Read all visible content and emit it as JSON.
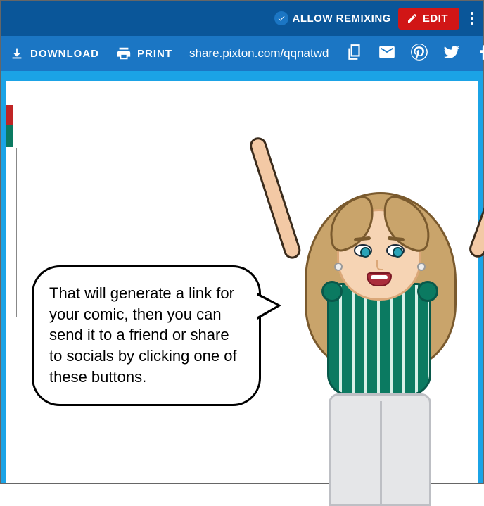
{
  "topbar": {
    "allow_remixing": "ALLOW REMIXING",
    "edit": "EDIT"
  },
  "subbar": {
    "download": "DOWNLOAD",
    "print": "PRINT",
    "share_link": "share.pixton.com/qqnatwd"
  },
  "bubble_text": "That will generate a link for your comic, then you can send it to a friend or share to socials by clicking one of these buttons."
}
